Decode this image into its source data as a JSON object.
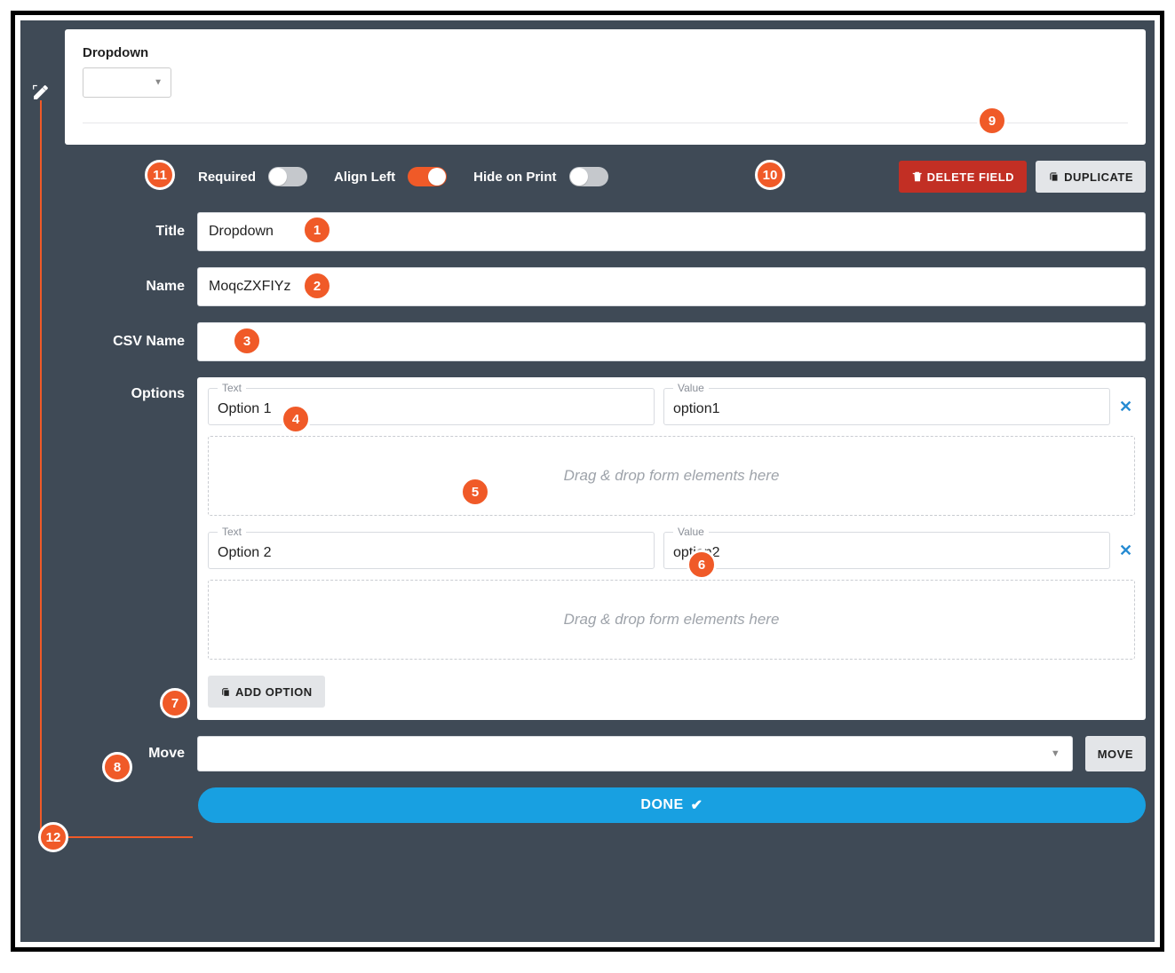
{
  "preview": {
    "section_title": "Dropdown"
  },
  "toggles": {
    "required_label": "Required",
    "required_on": false,
    "align_left_label": "Align Left",
    "align_left_on": true,
    "hide_on_print_label": "Hide on Print",
    "hide_on_print_on": false
  },
  "buttons": {
    "delete_label": "DELETE FIELD",
    "duplicate_label": "DUPLICATE",
    "add_option_label": "ADD OPTION",
    "move_label": "MOVE",
    "done_label": "DONE"
  },
  "labels": {
    "title": "Title",
    "name": "Name",
    "csv_name": "CSV Name",
    "options": "Options",
    "move": "Move",
    "opt_text": "Text",
    "opt_value": "Value"
  },
  "fields": {
    "title_value": "Dropdown",
    "name_value": "MoqcZXFIYz",
    "csv_value": ""
  },
  "options": [
    {
      "text": "Option 1",
      "value": "option1"
    },
    {
      "text": "Option 2",
      "value": "option2"
    }
  ],
  "dropzone_text": "Drag & drop form elements here",
  "callouts": [
    "1",
    "2",
    "3",
    "4",
    "5",
    "6",
    "7",
    "8",
    "9",
    "10",
    "11",
    "12"
  ]
}
